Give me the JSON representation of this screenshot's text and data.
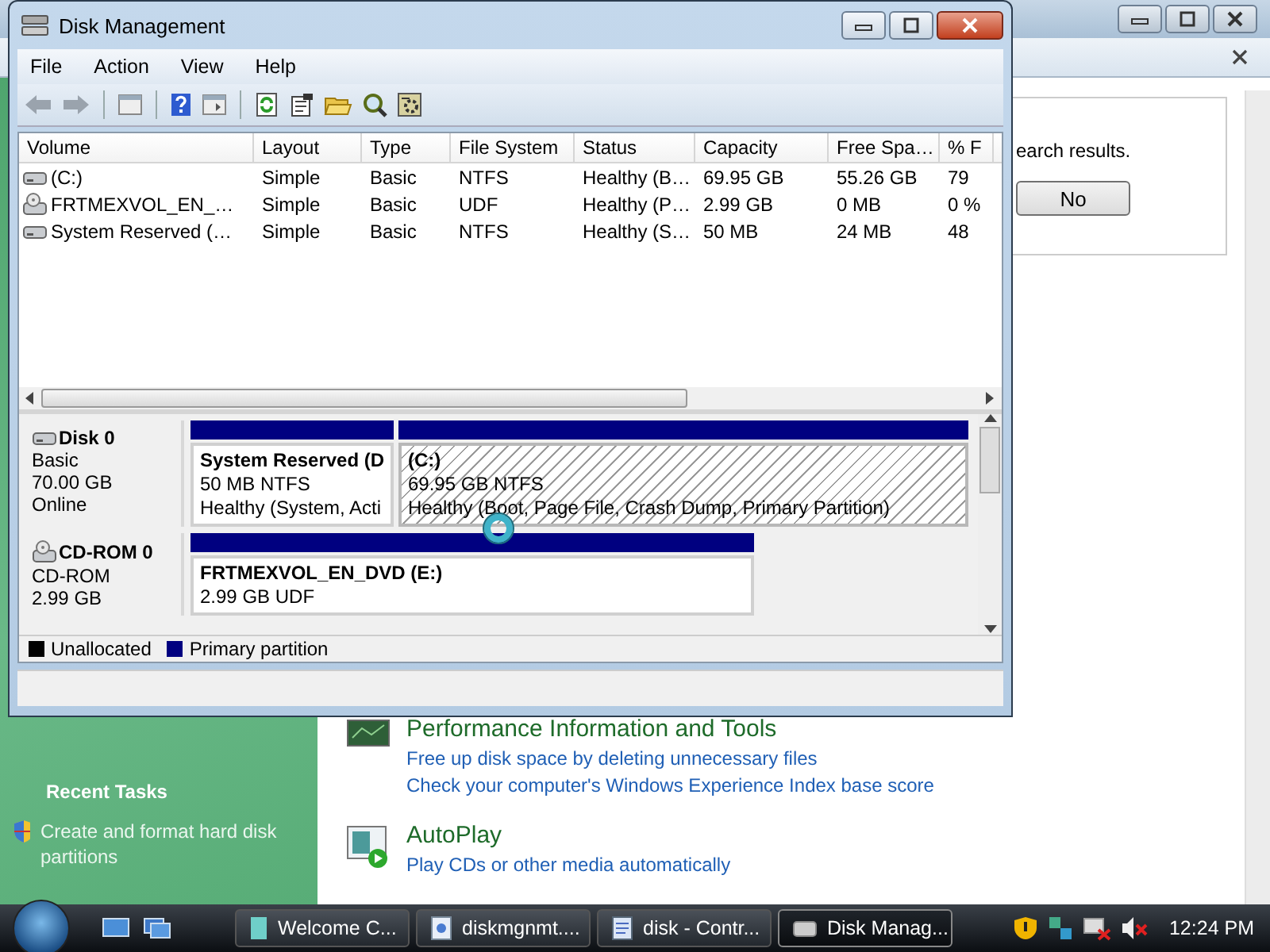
{
  "background_window": {
    "dialog": {
      "text": "earch results.",
      "button": "No"
    },
    "sidebar": {
      "heading": "Recent Tasks",
      "tasks": [
        {
          "label": "Create and format hard disk partitions"
        }
      ]
    },
    "sections": [
      {
        "kind": "performance",
        "title": "Performance Information and Tools",
        "links": [
          "Free up disk space by deleting unnecessary files",
          "Check your computer's Windows Experience Index base score"
        ]
      },
      {
        "kind": "autoplay",
        "title": "AutoPlay",
        "links": [
          "Play CDs or other media automatically"
        ]
      }
    ]
  },
  "window": {
    "title": "Disk Management",
    "menu": [
      "File",
      "Action",
      "View",
      "Help"
    ],
    "volumes": {
      "columns": [
        "Volume",
        "Layout",
        "Type",
        "File System",
        "Status",
        "Capacity",
        "Free Spa…",
        "% F"
      ],
      "rows": [
        {
          "kind": "drive",
          "cells": [
            "(C:)",
            "Simple",
            "Basic",
            "NTFS",
            "Healthy (B…",
            "69.95 GB",
            "55.26 GB",
            "79"
          ]
        },
        {
          "kind": "cdrom",
          "cells": [
            "FRTMEXVOL_EN_…",
            "Simple",
            "Basic",
            "UDF",
            "Healthy (P…",
            "2.99 GB",
            "0 MB",
            "0 %"
          ]
        },
        {
          "kind": "drive",
          "cells": [
            "System Reserved (…",
            "Simple",
            "Basic",
            "NTFS",
            "Healthy (S…",
            "50 MB",
            "24 MB",
            "48"
          ]
        }
      ]
    },
    "disks": [
      {
        "kind": "hdd",
        "name": "Disk 0",
        "lines": [
          "Basic",
          "70.00 GB",
          "Online"
        ],
        "partitions": [
          {
            "name": "System Reserved  (D",
            "lines": [
              "50 MB NTFS",
              "Healthy (System, Acti"
            ],
            "selected": false
          },
          {
            "name": "(C:)",
            "lines": [
              "69.95 GB NTFS",
              "Healthy (Boot, Page File, Crash Dump, Primary Partition)"
            ],
            "selected": true
          }
        ]
      },
      {
        "kind": "cdrom",
        "name": "CD-ROM 0",
        "lines": [
          "CD-ROM",
          "2.99 GB"
        ],
        "partitions": [
          {
            "name": "FRTMEXVOL_EN_DVD  (E:)",
            "lines": [
              "2.99 GB UDF"
            ],
            "selected": false
          }
        ]
      }
    ],
    "legend": [
      {
        "label": "Unallocated",
        "color": "#000000"
      },
      {
        "label": "Primary partition",
        "color": "#000080"
      }
    ]
  },
  "taskbar": {
    "items": [
      {
        "kind": "welcome",
        "label": "Welcome C...",
        "selected": false
      },
      {
        "kind": "document",
        "label": "diskmgnmt....",
        "selected": false
      },
      {
        "kind": "control",
        "label": "disk - Contr...",
        "selected": false
      },
      {
        "kind": "disk",
        "label": "Disk Manag...",
        "selected": true
      }
    ],
    "clock": "12:24 PM"
  }
}
